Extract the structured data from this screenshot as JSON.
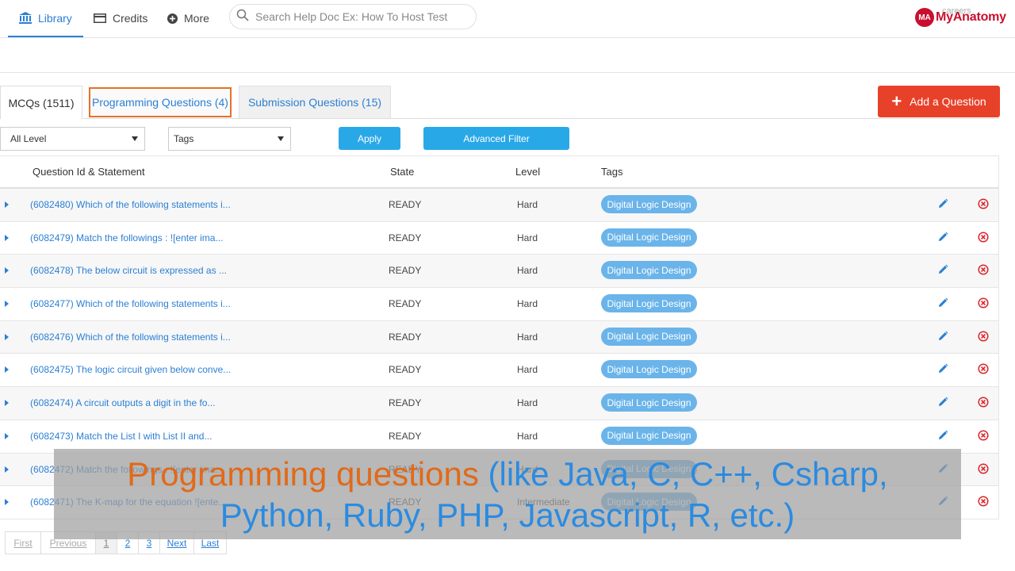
{
  "nav": {
    "library": "Library",
    "credits": "Credits",
    "more": "More",
    "search_placeholder": "Search Help Doc Ex: How To Host Test",
    "brand_mark": "MA",
    "brand_name": "MyAnatomy",
    "careers": "careers"
  },
  "tabs": [
    {
      "label": "MCQs (1511)"
    },
    {
      "label": "Programming Questions (4)"
    },
    {
      "label": "Submission Questions (15)"
    }
  ],
  "add_question_label": "Add a Question",
  "filters": {
    "level_value": "All Level",
    "tags_value": "Tags",
    "apply_label": "Apply",
    "advanced_label": "Advanced Filter"
  },
  "table": {
    "headers": {
      "statement": "Question Id & Statement",
      "state": "State",
      "level": "Level",
      "tags": "Tags"
    },
    "rows": [
      {
        "statement": "(6082480) Which of the following statements i...",
        "state": "READY",
        "level": "Hard",
        "tag": "Digital Logic Design"
      },
      {
        "statement": "(6082479) Match the followings : ![enter ima...",
        "state": "READY",
        "level": "Hard",
        "tag": "Digital Logic Design"
      },
      {
        "statement": "(6082478) The below circuit is expressed as ...",
        "state": "READY",
        "level": "Hard",
        "tag": "Digital Logic Design"
      },
      {
        "statement": "(6082477) Which of the following statements i...",
        "state": "READY",
        "level": "Hard",
        "tag": "Digital Logic Design"
      },
      {
        "statement": "(6082476) Which of the following statements i...",
        "state": "READY",
        "level": "Hard",
        "tag": "Digital Logic Design"
      },
      {
        "statement": "(6082475) The logic circuit given below conve...",
        "state": "READY",
        "level": "Hard",
        "tag": "Digital Logic Design"
      },
      {
        "statement": "(6082474) A circuit outputs a digit in the fo...",
        "state": "READY",
        "level": "Hard",
        "tag": "Digital Logic Design"
      },
      {
        "statement": "(6082473) Match the List I with List II and...",
        "state": "READY",
        "level": "Hard",
        "tag": "Digital Logic Design"
      },
      {
        "statement": "(6082472) Match the followings : ![enter ima...",
        "state": "READY",
        "level": "Hard",
        "tag": "Digital Logic Design"
      },
      {
        "statement": "(6082471) The K-map for the equation ![ente...",
        "state": "READY",
        "level": "Intermediate",
        "tag": "Digital Logic Design"
      }
    ]
  },
  "pager": {
    "first": "First",
    "previous": "Previous",
    "p1": "1",
    "p2": "2",
    "p3": "3",
    "next": "Next",
    "last": "Last"
  },
  "caption": {
    "highlight": "Programming questions",
    "line1_rest": " (like Java, C, C++, Csharp,",
    "line2": "Python, Ruby, PHP, Javascript, R, etc.)"
  },
  "colors": {
    "accent_blue": "#2b7fd4",
    "add_button": "#e8412a",
    "filter_button": "#29a8e8",
    "tag_pill": "#6ab4ea",
    "active_tab_border": "#e2722b",
    "brand": "#c8102e"
  },
  "icons": {
    "library": "bank-icon",
    "credits": "card-icon",
    "more": "plus-circle-icon",
    "search": "search-icon",
    "edit": "pencil-icon",
    "delete": "x-circle-icon",
    "expand": "caret-right-icon"
  }
}
